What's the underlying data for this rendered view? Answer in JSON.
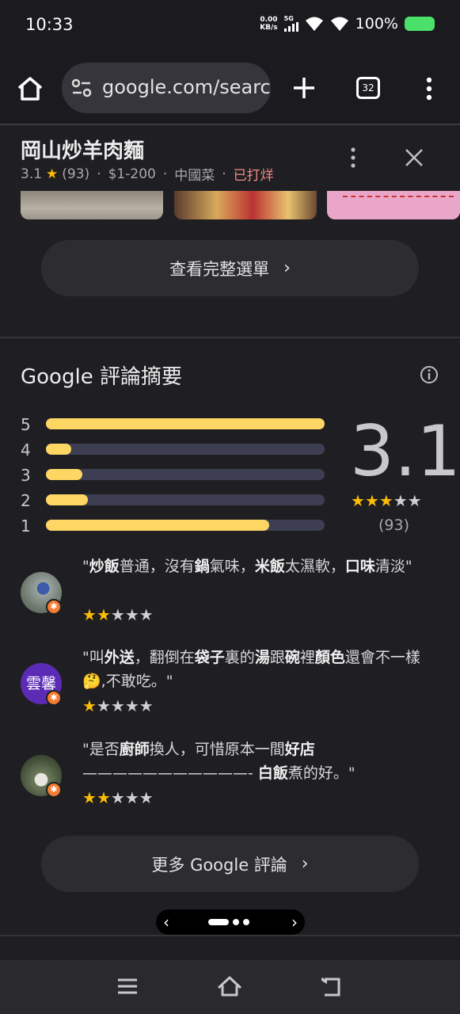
{
  "status": {
    "time": "10:33",
    "net_speed_value": "0.00",
    "net_speed_unit": "KB/s",
    "network": "5G",
    "battery": "100%"
  },
  "browser": {
    "url": "google.com/search",
    "tab_count": "32"
  },
  "place": {
    "name": "岡山炒羊肉麵",
    "rating": "3.1",
    "reviews_count": "(93)",
    "price": "$1-200",
    "category": "中國菜",
    "status": "已打烊"
  },
  "menu_button": {
    "label": "查看完整選單"
  },
  "summary": {
    "title": "Google 評論摘要",
    "rating": "3.1",
    "count": "(93)",
    "stars": 3,
    "distribution": [
      {
        "label": "5",
        "fraction": 1.0
      },
      {
        "label": "4",
        "fraction": 0.09
      },
      {
        "label": "3",
        "fraction": 0.13
      },
      {
        "label": "2",
        "fraction": 0.15
      },
      {
        "label": "1",
        "fraction": 0.8
      }
    ]
  },
  "reviews": [
    {
      "avatar": "photo-avatar",
      "segments": [
        {
          "t": "\"",
          "b": false
        },
        {
          "t": "炒飯",
          "b": true
        },
        {
          "t": "普通，沒有",
          "b": false
        },
        {
          "t": "鍋",
          "b": true
        },
        {
          "t": "氣味，",
          "b": false
        },
        {
          "t": "米飯",
          "b": true
        },
        {
          "t": "太濕軟，",
          "b": false
        },
        {
          "t": "口味",
          "b": true
        },
        {
          "t": "清淡\"",
          "b": false
        }
      ],
      "stars": 2
    },
    {
      "avatar": "雲馨",
      "avatar_color": "#5b2bb5",
      "segments": [
        {
          "t": "\"叫",
          "b": false
        },
        {
          "t": "外送",
          "b": true
        },
        {
          "t": "，翻倒在",
          "b": false
        },
        {
          "t": "袋子",
          "b": true
        },
        {
          "t": "裏的",
          "b": false
        },
        {
          "t": "湯",
          "b": true
        },
        {
          "t": "跟",
          "b": false
        },
        {
          "t": "碗",
          "b": true
        },
        {
          "t": "裡",
          "b": false
        },
        {
          "t": "顏色",
          "b": true
        },
        {
          "t": "還會不一樣🤔,不敢吃。\"",
          "b": false
        }
      ],
      "stars": 1
    },
    {
      "avatar": "photo-avatar",
      "segments": [
        {
          "t": "\"是否",
          "b": false
        },
        {
          "t": "廚師",
          "b": true
        },
        {
          "t": "換人，可惜原本一間",
          "b": false
        },
        {
          "t": "好店",
          "b": true
        },
        {
          "t": " ———————————- ",
          "b": false
        },
        {
          "t": "白飯",
          "b": true
        },
        {
          "t": "煮的好。\"",
          "b": false
        }
      ],
      "stars": 2
    }
  ],
  "more_reviews_button": {
    "label": "更多 Google 評論"
  },
  "colors": {
    "star": "#fbbc04",
    "bar_fill": "#fdd663",
    "bar_track": "#3d3e52",
    "closed": "#f28b82",
    "badge": "#f57c31"
  }
}
